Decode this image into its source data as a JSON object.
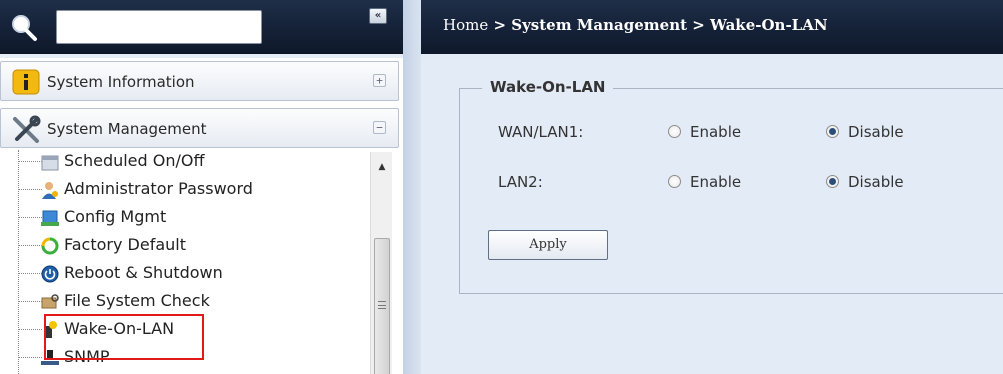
{
  "sidebar": {
    "search": {
      "value": "",
      "placeholder": ""
    },
    "collapse_label": "«",
    "groups": [
      {
        "label": "System Information",
        "toggle": "+"
      },
      {
        "label": "System Management",
        "toggle": "−"
      }
    ],
    "items": [
      {
        "label": "Scheduled On/Off",
        "icon": "scheduled-icon"
      },
      {
        "label": "Administrator Password",
        "icon": "admin-user-icon"
      },
      {
        "label": "Config Mgmt",
        "icon": "config-icon"
      },
      {
        "label": "Factory Default",
        "icon": "factory-reset-icon"
      },
      {
        "label": "Reboot & Shutdown",
        "icon": "power-icon"
      },
      {
        "label": "File System Check",
        "icon": "filesystem-icon"
      },
      {
        "label": "Wake-On-LAN",
        "icon": "wake-on-lan-icon",
        "selected": true
      },
      {
        "label": "SNMP",
        "icon": "snmp-icon"
      }
    ]
  },
  "breadcrumb": {
    "home": "Home",
    "sep1": " > ",
    "section": "System Management",
    "sep2": " > ",
    "page": "Wake-On-LAN"
  },
  "form": {
    "legend": "Wake-On-LAN",
    "rows": [
      {
        "label": "WAN/LAN1:",
        "enable": "Enable",
        "disable": "Disable",
        "selected": "Disable"
      },
      {
        "label": "LAN2:",
        "enable": "Enable",
        "disable": "Disable",
        "selected": "Disable"
      }
    ],
    "apply_label": "Apply"
  },
  "colors": {
    "header_bg": "#16233a",
    "content_bg": "#e3ebf7",
    "highlight": "#e11919"
  }
}
